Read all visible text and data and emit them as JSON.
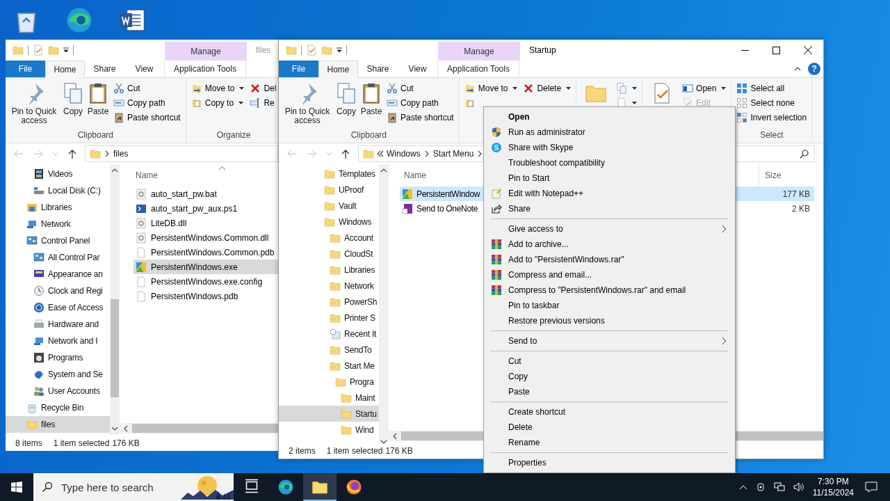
{
  "desktop_icons": [
    {
      "kind": "recycle-bin"
    },
    {
      "kind": "edge"
    },
    {
      "kind": "word"
    }
  ],
  "left_window": {
    "active": false,
    "title": "files",
    "context_tab": "Manage",
    "tabs": [
      {
        "label": "File",
        "kind": "file",
        "selected": false
      },
      {
        "label": "Home",
        "kind": "tab",
        "selected": true
      },
      {
        "label": "Share",
        "kind": "tab",
        "selected": false
      },
      {
        "label": "View",
        "kind": "tab",
        "selected": false
      },
      {
        "label": "Application Tools",
        "kind": "context",
        "selected": false
      }
    ],
    "ribbon": [
      {
        "label": "Clipboard",
        "columns": [
          {
            "kind": "large",
            "items": [
              {
                "label": "Pin to Quick access",
                "kind": "pin"
              }
            ]
          },
          {
            "kind": "large",
            "items": [
              {
                "label": "Copy",
                "kind": "copy"
              }
            ]
          },
          {
            "kind": "large",
            "items": [
              {
                "label": "Paste",
                "kind": "paste"
              }
            ]
          },
          {
            "kind": "small",
            "items": [
              {
                "label": "Cut",
                "kind": "scissors"
              },
              {
                "label": "Copy path",
                "kind": "copy-path"
              },
              {
                "label": "Paste shortcut",
                "kind": "paste-shortcut"
              }
            ]
          }
        ]
      },
      {
        "label": "Organize",
        "columns": [
          {
            "kind": "small",
            "items": [
              {
                "label": "Move to",
                "kind": "move-to",
                "dropdown": true
              },
              {
                "label": "Copy to",
                "kind": "copy-to",
                "dropdown": true
              }
            ]
          },
          {
            "kind": "small",
            "items": [
              {
                "label": "Del",
                "kind": "cross",
                "dropdown": false
              },
              {
                "label": "Re",
                "kind": "rename",
                "dropdown": false
              }
            ]
          }
        ]
      }
    ],
    "address": {
      "overflow": false,
      "more": false,
      "segments": [
        "files"
      ]
    },
    "nav": [
      {
        "children": [
          {
            "label": "Videos",
            "kind": "film",
            "selected": false
          },
          {
            "label": "Local Disk (C:)",
            "kind": "disk",
            "selected": false
          }
        ]
      },
      {
        "label": "Libraries",
        "kind": "library",
        "selected": false
      },
      {
        "label": "Network",
        "kind": "network",
        "selected": false
      },
      {
        "label": "Control Panel",
        "kind": "control-panel",
        "selected": false,
        "children": [
          {
            "label": "All Control Par",
            "kind": "control-panel",
            "selected": false
          },
          {
            "label": "Appearance an",
            "kind": "display",
            "selected": false
          },
          {
            "label": "Clock and Regi",
            "kind": "clock",
            "selected": false
          },
          {
            "label": "Ease of Access",
            "kind": "accessibility",
            "selected": false
          },
          {
            "label": "Hardware and",
            "kind": "printer",
            "selected": false
          },
          {
            "label": "Network and I",
            "kind": "network",
            "selected": false
          },
          {
            "label": "Programs",
            "kind": "disc",
            "selected": false
          },
          {
            "label": "System and Se",
            "kind": "security",
            "selected": false
          },
          {
            "label": "User Accounts",
            "kind": "users",
            "selected": false
          }
        ]
      },
      {
        "label": "Recycle Bin",
        "kind": "recycle-bin",
        "selected": false
      },
      {
        "label": "files",
        "kind": "folder",
        "selected": true
      }
    ],
    "columns": [
      {
        "label": "Name"
      }
    ],
    "files": [
      {
        "name": "auto_start_pw.bat",
        "kind": "gear-file",
        "selected": false
      },
      {
        "name": "auto_start_pw_aux.ps1",
        "kind": "terminal",
        "selected": false
      },
      {
        "name": "LiteDB.dll",
        "kind": "gear-file",
        "selected": false
      },
      {
        "name": "PersistentWindows.Common.dll",
        "kind": "gear-file",
        "selected": false
      },
      {
        "name": "PersistentWindows.Common.pdb",
        "kind": "blank-file",
        "selected": false
      },
      {
        "name": "PersistentWindows.exe",
        "kind": "app-tile",
        "selected": true
      },
      {
        "name": "PersistentWindows.exe.config",
        "kind": "blank-file",
        "selected": false
      },
      {
        "name": "PersistentWindows.pdb",
        "kind": "blank-file",
        "selected": false
      }
    ],
    "status": {
      "count": "8 items",
      "selection": "1 item selected",
      "size": "176 KB"
    }
  },
  "right_window": {
    "active": true,
    "title": "Startup",
    "context_tab": "Manage",
    "help": "?",
    "tabs": [
      {
        "label": "File",
        "kind": "file",
        "selected": false
      },
      {
        "label": "Home",
        "kind": "tab",
        "selected": true
      },
      {
        "label": "Share",
        "kind": "tab",
        "selected": false
      },
      {
        "label": "View",
        "kind": "tab",
        "selected": false
      },
      {
        "label": "Application Tools",
        "kind": "context",
        "selected": false
      }
    ],
    "ribbon": [
      {
        "label": "Clipboard",
        "columns": [
          {
            "kind": "large",
            "items": [
              {
                "label": "Pin to Quick access",
                "kind": "pin"
              }
            ]
          },
          {
            "kind": "large",
            "items": [
              {
                "label": "Copy",
                "kind": "copy"
              }
            ]
          },
          {
            "kind": "large",
            "items": [
              {
                "label": "Paste",
                "kind": "paste"
              }
            ]
          },
          {
            "kind": "small",
            "items": [
              {
                "label": "Cut",
                "kind": "scissors"
              },
              {
                "label": "Copy path",
                "kind": "copy-path"
              },
              {
                "label": "Paste shortcut",
                "kind": "paste-shortcut"
              }
            ]
          }
        ]
      },
      {
        "columns": [
          {
            "kind": "small",
            "items": [
              {
                "label": "Move to",
                "kind": "move-to",
                "dropdown": true
              },
              {
                "kind": "copy-to"
              }
            ]
          },
          {
            "kind": "small",
            "items": [
              {
                "label": "Delete",
                "kind": "cross",
                "dropdown": true
              }
            ]
          }
        ]
      },
      {
        "columns": [
          {
            "kind": "large",
            "items": [
              {
                "kind": "folder"
              }
            ]
          },
          {
            "kind": "small",
            "items": [
              {
                "kind": "copy",
                "dropdown": true
              },
              {
                "kind": "blank-file",
                "dropdown": true
              }
            ]
          }
        ]
      },
      {
        "columns": [
          {
            "kind": "large",
            "items": [
              {
                "kind": "checklist"
              }
            ]
          },
          {
            "kind": "small",
            "items": [
              {
                "label": "Open",
                "kind": "open",
                "dropdown": true,
                "disabled": false
              },
              {
                "label": "Edit",
                "kind": "edit",
                "dropdown": false,
                "disabled": true
              }
            ]
          }
        ]
      },
      {
        "label": "Select",
        "columns": [
          {
            "kind": "small",
            "items": [
              {
                "label": "Select all",
                "kind": "select-all"
              },
              {
                "label": "Select none",
                "kind": "select-none"
              },
              {
                "label": "Invert selection",
                "kind": "invert-selection"
              }
            ]
          }
        ]
      }
    ],
    "address": {
      "overflow": true,
      "more": true,
      "segments": [
        "Windows",
        "Start Menu"
      ]
    },
    "nav": [
      {
        "label": "Templates",
        "kind": "folder",
        "selected": false
      },
      {
        "label": "UProof",
        "kind": "folder",
        "selected": false
      },
      {
        "label": "Vault",
        "kind": "folder",
        "selected": false
      },
      {
        "label": "Windows",
        "kind": "folder",
        "selected": false,
        "children": [
          {
            "label": "Account",
            "kind": "folder",
            "selected": false
          },
          {
            "label": "CloudSt",
            "kind": "folder",
            "selected": false
          },
          {
            "label": "Libraries",
            "kind": "folder",
            "selected": false
          },
          {
            "label": "Network",
            "kind": "folder",
            "selected": false
          },
          {
            "label": "PowerSh",
            "kind": "folder",
            "selected": false
          },
          {
            "label": "Printer S",
            "kind": "folder",
            "selected": false
          },
          {
            "label": "Recent It",
            "kind": "recent",
            "selected": false
          },
          {
            "label": "SendTo",
            "kind": "folder",
            "selected": false
          },
          {
            "label": "Start Me",
            "kind": "folder",
            "selected": false,
            "children": [
              {
                "label": "Progra",
                "kind": "folder",
                "selected": false,
                "children": [
                  {
                    "label": "Maint",
                    "kind": "folder",
                    "selected": false
                  },
                  {
                    "label": "Startu",
                    "kind": "folder",
                    "selected": true
                  },
                  {
                    "label": "Wind",
                    "kind": "folder",
                    "selected": false
                  }
                ]
              }
            ]
          }
        ]
      }
    ],
    "columns": [
      {
        "label": "Name"
      },
      {
        "label": "Size"
      }
    ],
    "files": [
      {
        "name": "PersistentWindow",
        "size": "177 KB",
        "kind": "app-tile",
        "selected": true
      },
      {
        "name": "Send to OneNote",
        "size": "2 KB",
        "kind": "note-shortcut",
        "selected": false
      }
    ],
    "status": {
      "count": "2 items",
      "selection": "1 item selected",
      "size": "176 KB"
    }
  },
  "context_menu": [
    {
      "kind": "plain",
      "label": "Open",
      "default": true
    },
    {
      "kind": "shield",
      "label": "Run as administrator"
    },
    {
      "kind": "skype",
      "label": "Share with Skype"
    },
    {
      "kind": "plain",
      "label": "Troubleshoot compatibility"
    },
    {
      "kind": "plain",
      "label": "Pin to Start"
    },
    {
      "kind": "notepad",
      "label": "Edit with Notepad++"
    },
    {
      "kind": "share",
      "label": "Share"
    },
    {
      "kind": "separator"
    },
    {
      "kind": "plain",
      "label": "Give access to",
      "submenu": true
    },
    {
      "kind": "archive",
      "label": "Add to archive..."
    },
    {
      "kind": "archive",
      "label": "Add to \"PersistentWindows.rar\""
    },
    {
      "kind": "archive",
      "label": "Compress and email..."
    },
    {
      "kind": "archive",
      "label": "Compress to \"PersistentWindows.rar\" and email"
    },
    {
      "kind": "plain",
      "label": "Pin to taskbar"
    },
    {
      "kind": "plain",
      "label": "Restore previous versions"
    },
    {
      "kind": "separator"
    },
    {
      "kind": "plain",
      "label": "Send to",
      "submenu": true
    },
    {
      "kind": "separator"
    },
    {
      "kind": "plain",
      "label": "Cut"
    },
    {
      "kind": "plain",
      "label": "Copy"
    },
    {
      "kind": "plain",
      "label": "Paste"
    },
    {
      "kind": "separator"
    },
    {
      "kind": "plain",
      "label": "Create shortcut"
    },
    {
      "kind": "plain",
      "label": "Delete"
    },
    {
      "kind": "plain",
      "label": "Rename"
    },
    {
      "kind": "separator"
    },
    {
      "kind": "plain",
      "label": "Properties"
    }
  ],
  "taskbar": {
    "search_placeholder": "Type here to search",
    "apps": [
      {
        "kind": "task-view",
        "active": false
      },
      {
        "kind": "edge",
        "active": false
      },
      {
        "kind": "folder",
        "active": true
      },
      {
        "kind": "firefox",
        "active": false
      }
    ],
    "time": "7:30 PM",
    "date": "11/15/2024"
  }
}
